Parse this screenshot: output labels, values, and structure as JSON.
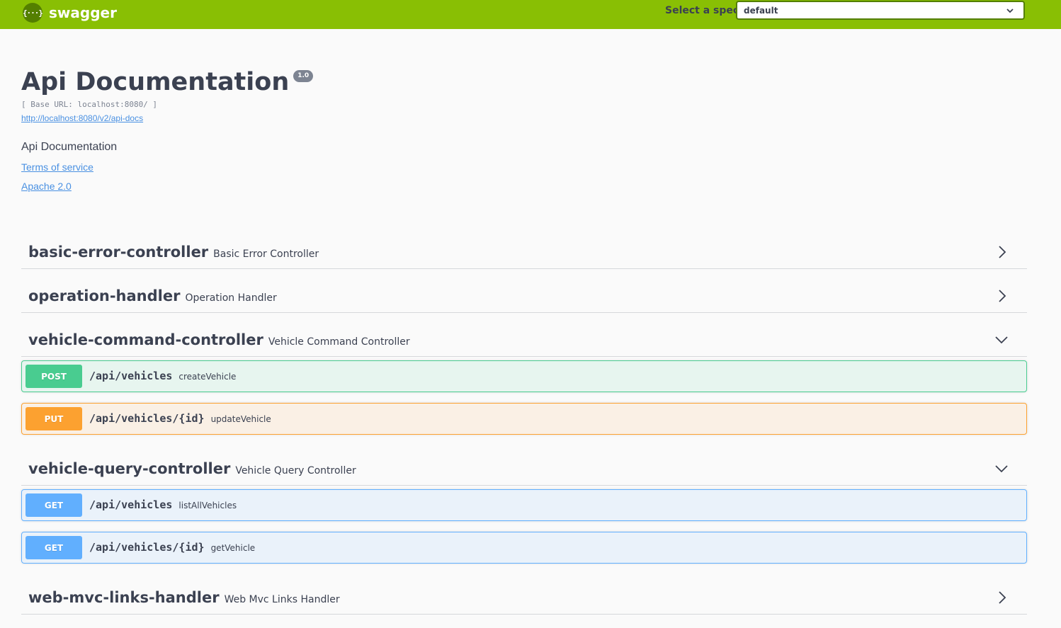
{
  "topbar": {
    "logo_glyph": "{···}",
    "logo_text": "swagger",
    "spec_label": "Select a spec",
    "spec_value": "default",
    "colors": {
      "bar": "#89bf04",
      "logo_badge": "#547f00"
    }
  },
  "info": {
    "title": "Api Documentation",
    "version": "1.0",
    "base_url": "[ Base URL: localhost:8080/ ]",
    "docs_url": "http://localhost:8080/v2/api-docs",
    "description": "Api Documentation",
    "terms_of_service": "Terms of service",
    "license": "Apache 2.0"
  },
  "tags": [
    {
      "name": "basic-error-controller",
      "description": "Basic Error Controller",
      "expanded": false,
      "operations": []
    },
    {
      "name": "operation-handler",
      "description": "Operation Handler",
      "expanded": false,
      "operations": []
    },
    {
      "name": "vehicle-command-controller",
      "description": "Vehicle Command Controller",
      "expanded": true,
      "operations": [
        {
          "method": "POST",
          "path": "/api/vehicles",
          "summary": "createVehicle"
        },
        {
          "method": "PUT",
          "path": "/api/vehicles/{id}",
          "summary": "updateVehicle"
        }
      ]
    },
    {
      "name": "vehicle-query-controller",
      "description": "Vehicle Query Controller",
      "expanded": true,
      "operations": [
        {
          "method": "GET",
          "path": "/api/vehicles",
          "summary": "listAllVehicles"
        },
        {
          "method": "GET",
          "path": "/api/vehicles/{id}",
          "summary": "getVehicle"
        }
      ]
    },
    {
      "name": "web-mvc-links-handler",
      "description": "Web Mvc Links Handler",
      "expanded": false,
      "operations": []
    }
  ],
  "method_colors": {
    "POST": "#49cc90",
    "PUT": "#fca130",
    "GET": "#61affe"
  }
}
